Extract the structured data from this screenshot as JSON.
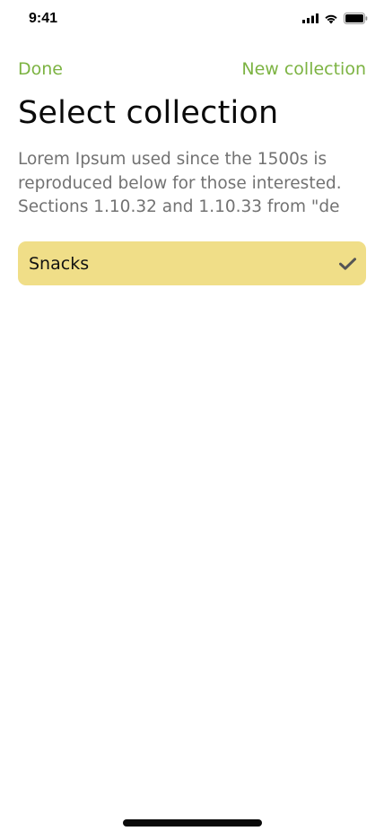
{
  "status_bar": {
    "time": "9:41",
    "icons": [
      "cellular-signal-icon",
      "wifi-icon",
      "battery-icon"
    ]
  },
  "nav": {
    "done_label": "Done",
    "new_collection_label": "New collection"
  },
  "header": {
    "title": "Select collection",
    "description": "Lorem Ipsum used since the 1500s is reproduced below for those interested. Sections 1.10.32 and 1.10.33 from \"de"
  },
  "collections": [
    {
      "label": "Snacks",
      "selected": true,
      "icon": "checkmark-icon"
    }
  ],
  "colors": {
    "accent": "#7cb342",
    "selected_item_bg": "#f0de88",
    "description_text": "#727272",
    "check": "#555555"
  }
}
